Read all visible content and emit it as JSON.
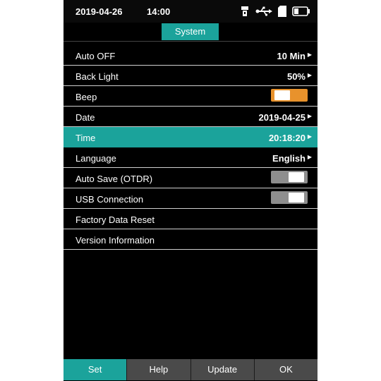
{
  "status": {
    "date": "2019-04-26",
    "time": "14:00",
    "icons": [
      "flashlight-icon",
      "usb-icon",
      "sd-card-icon",
      "battery-icon"
    ]
  },
  "tab": {
    "title": "System"
  },
  "menu": {
    "auto_off": {
      "label": "Auto OFF",
      "value": "10 Min"
    },
    "back_light": {
      "label": "Back Light",
      "value": "50%"
    },
    "beep": {
      "label": "Beep",
      "state": "on"
    },
    "date": {
      "label": "Date",
      "value": "2019-04-25"
    },
    "time": {
      "label": "Time",
      "value": "20:18:20",
      "selected": true
    },
    "language": {
      "label": "Language",
      "value": "English"
    },
    "auto_save": {
      "label": "Auto Save (OTDR)",
      "state": "off"
    },
    "usb_connection": {
      "label": "USB Connection",
      "state": "off"
    },
    "factory_reset": {
      "label": "Factory Data Reset"
    },
    "version_info": {
      "label": "Version Information"
    }
  },
  "bottom": {
    "set": "Set",
    "help": "Help",
    "update": "Update",
    "ok": "OK",
    "active": "Set"
  },
  "colors": {
    "accent": "#1ba39b",
    "toggle_on": "#e8922c",
    "toggle_off": "#8e8e8e",
    "background": "#000000",
    "button": "#4a4a4a"
  }
}
